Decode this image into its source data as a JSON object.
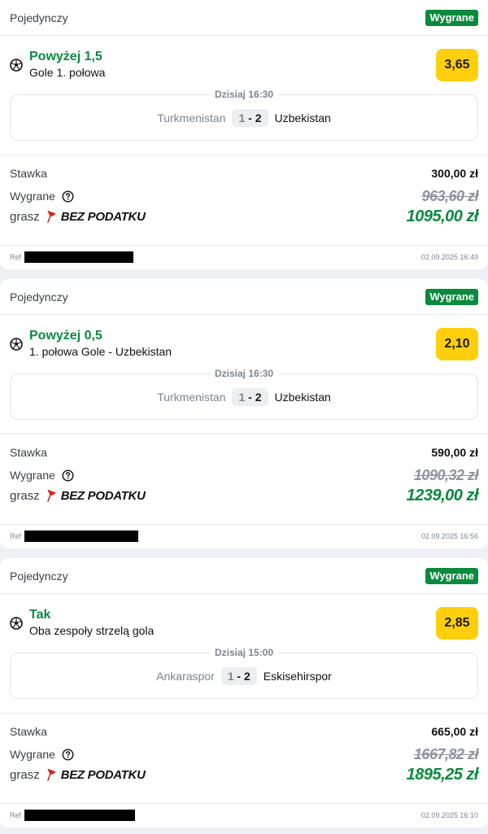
{
  "tickets": [
    {
      "bet_type": "Pojedynczy",
      "status": "Wygrane",
      "selection": "Powyżej 1,5",
      "market": "Gole 1. połowa",
      "odds": "3,65",
      "match_time": "Dzisiaj 16:30",
      "home_team": "Turkmenistan",
      "away_team": "Uzbekistan",
      "score_home": "1",
      "score_sep": " - ",
      "score_away": "2",
      "stake_label": "Stawka",
      "stake": "300,00 zł",
      "win_label": "Wygrane",
      "old_win": "963,60 zł",
      "promo_prefix": "grasz",
      "promo_text": "BEZ PODATKU",
      "new_win": "1095,00 zł",
      "ref_label": "Ref",
      "date": "02.09.2025 16:49"
    },
    {
      "bet_type": "Pojedynczy",
      "status": "Wygrane",
      "selection": "Powyżej 0,5",
      "market": "1. połowa Gole - Uzbekistan",
      "odds": "2,10",
      "match_time": "Dzisiaj 16:30",
      "home_team": "Turkmenistan",
      "away_team": "Uzbekistan",
      "score_home": "1",
      "score_sep": " - ",
      "score_away": "2",
      "stake_label": "Stawka",
      "stake": "590,00 zł",
      "win_label": "Wygrane",
      "old_win": "1090,32 zł",
      "promo_prefix": "grasz",
      "promo_text": "BEZ PODATKU",
      "new_win": "1239,00 zł",
      "ref_label": "Ref",
      "date": "02.09.2025 16:56"
    },
    {
      "bet_type": "Pojedynczy",
      "status": "Wygrane",
      "selection": "Tak",
      "market": "Oba zespoły strzelą gola",
      "odds": "2,85",
      "match_time": "Dzisiaj 15:00",
      "home_team": "Ankaraspor",
      "away_team": "Eskisehirspor",
      "score_home": "1",
      "score_sep": " - ",
      "score_away": "2",
      "stake_label": "Stawka",
      "stake": "665,00 zł",
      "win_label": "Wygrane",
      "old_win": "1667,82 zł",
      "promo_prefix": "grasz",
      "promo_text": "BEZ PODATKU",
      "new_win": "1895,25 zł",
      "ref_label": "Ref",
      "date": "02.09.2025 16:10"
    }
  ],
  "colors": {
    "win_green": "#0a8a3c",
    "odds_yellow": "#ffcf0d",
    "promo_red": "#e2231a",
    "muted": "#7d8590"
  },
  "icons": {
    "sport": "soccer-ball-icon",
    "help": "question-circle-icon",
    "promo": "pin-flag-icon"
  }
}
